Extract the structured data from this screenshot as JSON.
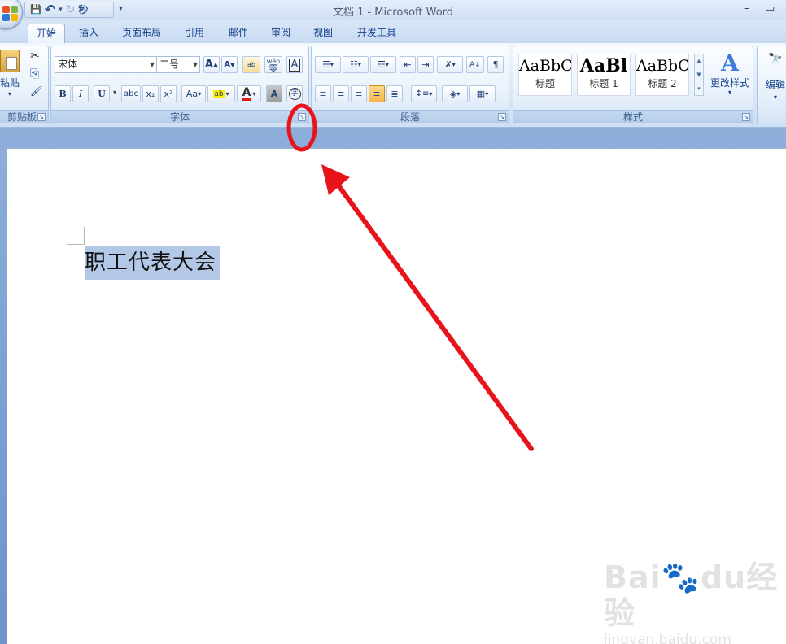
{
  "window": {
    "title": "文档 1 - Microsoft Word",
    "minimize": "–",
    "maximize": "▭"
  },
  "qat": {
    "save": "💾",
    "undo": "↶",
    "undo_dd": "▾",
    "redo": "↻",
    "custom": "秒",
    "more": "▾"
  },
  "tabs": [
    {
      "label": "开始",
      "active": true
    },
    {
      "label": "插入"
    },
    {
      "label": "页面布局"
    },
    {
      "label": "引用"
    },
    {
      "label": "邮件"
    },
    {
      "label": "审阅"
    },
    {
      "label": "视图"
    },
    {
      "label": "开发工具"
    }
  ],
  "clipboard": {
    "label": "剪贴板",
    "paste": "粘贴",
    "paste_dd": "▾",
    "cut": "✂",
    "copy": "⎘",
    "format_painter": "🖌"
  },
  "font": {
    "label": "字体",
    "font_name": "宋体",
    "font_size": "二号",
    "grow": "A",
    "shrink": "A",
    "clear": "ab",
    "pinyin": "wén",
    "pinyin_char": "雯",
    "border": "A",
    "bold": "B",
    "italic": "I",
    "underline": "U",
    "underline_dd": "▾",
    "strike": "abc",
    "subscript": "x₂",
    "superscript": "x²",
    "case": "Aa",
    "highlight": "ab",
    "font_color": "A",
    "shading": "A",
    "enclose": "字"
  },
  "paragraph": {
    "label": "段落",
    "bullets": "☰",
    "numbering": "☷",
    "multilevel": "☲",
    "decrease_indent": "⇤",
    "increase_indent": "⇥",
    "chinese_layout": "✗",
    "sort": "A↓",
    "marks": "¶",
    "align_left": "≡",
    "align_center": "≡",
    "align_right": "≡",
    "justify": "≡",
    "distributed": "≣",
    "line_spacing": "↕≡",
    "shading": "◈",
    "borders": "▦"
  },
  "styles": {
    "label": "样式",
    "cards": [
      {
        "sample": "AaBbC",
        "name": "标题"
      },
      {
        "sample": "AaBl",
        "name": "标题 1"
      },
      {
        "sample": "AaBbC",
        "name": "标题 2"
      }
    ],
    "change_styles": "更改样式",
    "change_icon": "A",
    "dd": "▾"
  },
  "editing": {
    "icon": "🔭",
    "label": "编辑",
    "dd": "▾"
  },
  "document": {
    "selected_text": "职工代表大会"
  },
  "annotation": {
    "color": "#e8141b"
  },
  "watermark": {
    "main": "Bai🐾du经验",
    "sub": "jingyan.baidu.com"
  }
}
